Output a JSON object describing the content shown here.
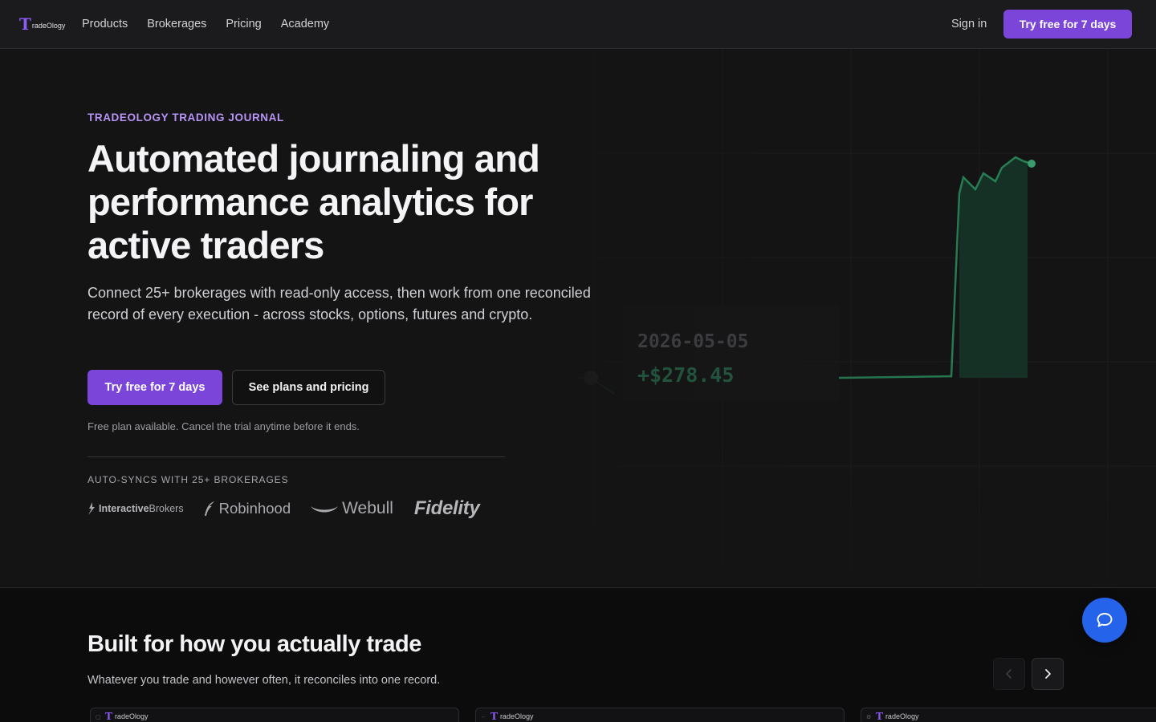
{
  "nav": {
    "logo_mark": "T",
    "logo_text": "radeOlogy",
    "links": [
      "Products",
      "Brokerages",
      "Pricing",
      "Academy"
    ],
    "signin": "Sign in",
    "cta": "Try free for 7 days"
  },
  "hero": {
    "eyebrow": "TRADEOLOGY TRADING JOURNAL",
    "headline": "Automated journaling and performance analytics for active traders",
    "sub": "Connect 25+ brokerages with read-only access, then work from one reconciled record of every execution - across stocks, options, futures and crypto.",
    "primary_cta": "Try free for 7 days",
    "secondary_cta": "See plans and pricing",
    "note": "Free plan available. Cancel the trial anytime before it ends.",
    "sync_label": "AUTO-SYNCS WITH 25+ BROKERAGES",
    "brokers": {
      "ib_bold": "Interactive",
      "ib_rest": "Brokers",
      "robinhood": "Robinhood",
      "webull": "Webull",
      "fidelity": "Fidelity"
    },
    "chart": {
      "date": "2026-05-05",
      "value": "+$278.45",
      "line_color": "#2ea36b"
    }
  },
  "section2": {
    "title": "Built for how you actually trade",
    "sub": "Whatever you trade and however often, it reconciles into one record.",
    "cards": [
      {
        "logo_mark": "T",
        "logo_text": "radeOlogy"
      },
      {
        "logo_mark": "T",
        "logo_text": "radeOlogy"
      },
      {
        "logo_mark": "T",
        "logo_text": "radeOlogy"
      }
    ]
  },
  "colors": {
    "accent": "#7b45d9",
    "eyebrow": "#b794f6",
    "chat": "#2563eb"
  },
  "icons": [
    "chevron-left-icon",
    "chevron-right-icon",
    "chat-bubble-icon",
    "feather-icon",
    "wave-icon"
  ]
}
